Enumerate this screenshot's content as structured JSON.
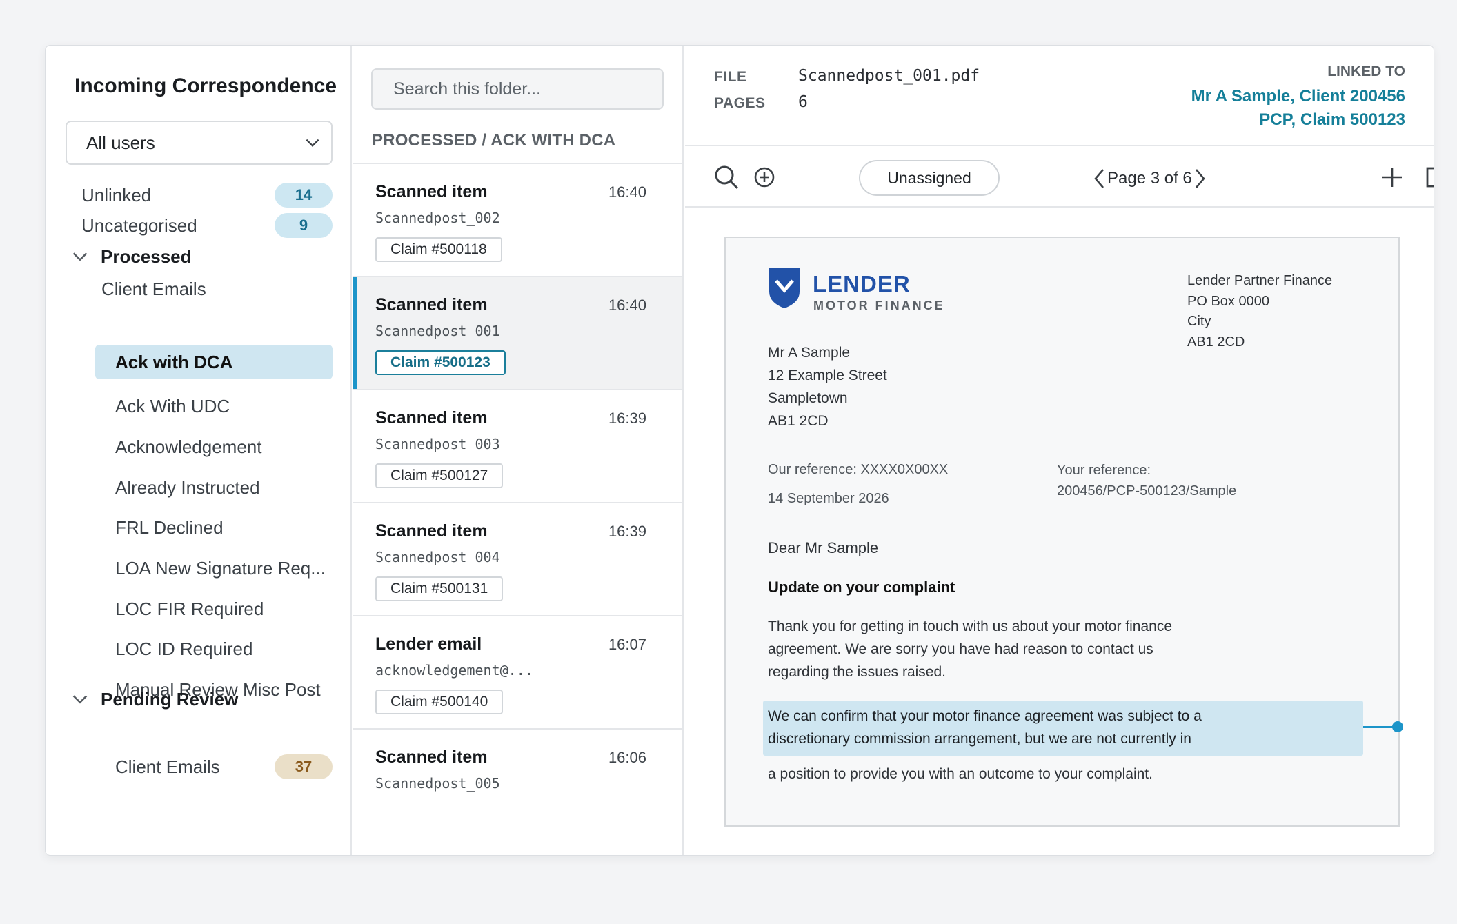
{
  "sidebar": {
    "title": "Incoming Correspondence",
    "user_filter": "All users",
    "unlinked": {
      "label": "Unlinked",
      "count": "14"
    },
    "uncategorised": {
      "label": "Uncategorised",
      "count": "9"
    },
    "processed": {
      "label": "Processed",
      "items": [
        "Client Emails",
        "Ack with DCA",
        "Ack With UDC",
        "Acknowledgement",
        "Already Instructed",
        "FRL Declined",
        "LOA New Signature Req...",
        "LOC FIR Required",
        "LOC ID Required",
        "Manual Review Misc Post"
      ]
    },
    "pending": {
      "label": "Pending Review",
      "items": [
        {
          "label": "Client Emails",
          "count": "37"
        }
      ]
    }
  },
  "middle": {
    "search_placeholder": "Search this folder...",
    "folder_heading": "PROCESSED / ACK WITH DCA",
    "items": [
      {
        "title": "Scanned item",
        "time": "16:40",
        "sub": "Scannedpost_002",
        "claim": "Claim #500118"
      },
      {
        "title": "Scanned item",
        "time": "16:40",
        "sub": "Scannedpost_001",
        "claim": "Claim #500123"
      },
      {
        "title": "Scanned item",
        "time": "16:39",
        "sub": "Scannedpost_003",
        "claim": "Claim #500127"
      },
      {
        "title": "Scanned item",
        "time": "16:39",
        "sub": "Scannedpost_004",
        "claim": "Claim #500131"
      },
      {
        "title": "Lender email",
        "time": "16:07",
        "sub": "acknowledgement@...",
        "claim": "Claim #500140"
      },
      {
        "title": "Scanned item",
        "time": "16:06",
        "sub": "Scannedpost_005"
      }
    ]
  },
  "viewer": {
    "file_label": "FILE",
    "file_value": "Scannedpost_001.pdf",
    "pages_label": "PAGES",
    "pages_value": "6",
    "linked_label": "LINKED TO",
    "linked_line1": "Mr A Sample, Client 200456",
    "linked_line2": "PCP, Claim 500123",
    "assignee": "Unassigned",
    "page_indicator": "Page 3 of 6"
  },
  "letter": {
    "brand": "LENDER",
    "brand_sub": "MOTOR FINANCE",
    "sender": [
      "Lender Partner Finance",
      "PO Box 0000",
      "City",
      "AB1 2CD"
    ],
    "recipient": [
      "Mr A Sample",
      "12 Example Street",
      "Sampletown",
      "AB1 2CD"
    ],
    "our_ref": "Our reference: XXXX0X00XX",
    "date": "14 September 2026",
    "your_ref_label": "Your reference:",
    "your_ref": "200456/PCP-500123/Sample",
    "salutation": "Dear Mr Sample",
    "subject": "Update on your complaint",
    "para1": [
      "Thank you for getting in touch with us about your motor finance",
      "agreement. We are sorry you have had reason to contact us",
      "regarding the issues raised."
    ],
    "para2_highlighted": [
      "We can confirm that your motor finance agreement was subject to a",
      "discretionary commission arrangement, but we are not currently in"
    ],
    "para2_rest": "a position to provide you with an outcome to your complaint."
  },
  "colors": {
    "accent": "#1d95c9",
    "link": "#157f99",
    "brand": "#2252a8",
    "highlight": "#cfe6f1"
  }
}
